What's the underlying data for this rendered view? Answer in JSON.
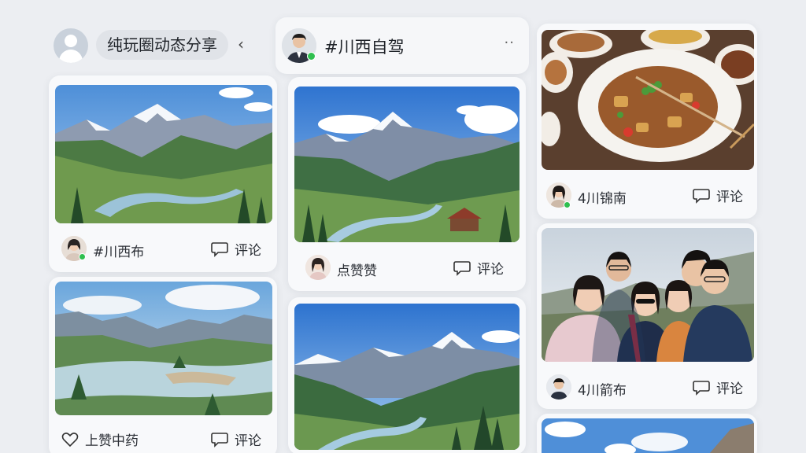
{
  "header": {
    "title": "纯玩圈动态分享",
    "chevron": "‹"
  },
  "column2": {
    "title": "#川西自驾",
    "more": "··"
  },
  "posts": [
    {
      "id": "p1",
      "author": "#川西布",
      "action": "评论"
    },
    {
      "id": "p2",
      "author": "点赞赞",
      "action": "评论"
    },
    {
      "id": "p3",
      "author": "上赞中药",
      "action": "评论"
    },
    {
      "id": "p4",
      "author": "4川锦南",
      "action": "评论"
    },
    {
      "id": "p5",
      "author": "4川箭布",
      "action": "评论"
    }
  ],
  "icons": {
    "comment": "comment-bubble-icon",
    "like": "heart-icon",
    "online": "online-status-dot",
    "more": "more-dots-icon"
  },
  "colors": {
    "background": "#eceef2",
    "online": "#2fbf4f",
    "pill": "#e0e3e8"
  }
}
